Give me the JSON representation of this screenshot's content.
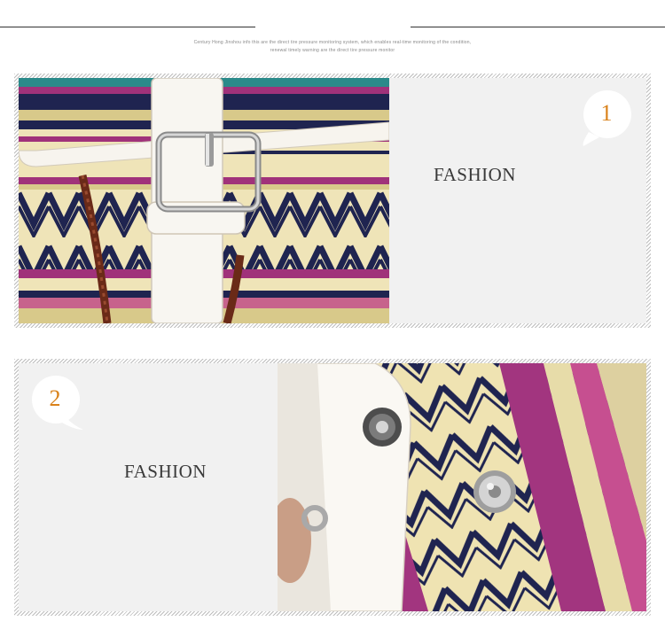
{
  "caption": {
    "line1": "Century Hong Jinshou info this are the direct tire pressure monitoring system, which enables real-time monitoring of the condition,",
    "line2": "renewal timely warning are the direct tire pressure monitor"
  },
  "sections": [
    {
      "number": "1",
      "label": "FASHION",
      "photo_subject": "buckle-strap-detail"
    },
    {
      "number": "2",
      "label": "FASHION",
      "photo_subject": "magnetic-snap-detail"
    }
  ],
  "colors": {
    "accent_number": "#d9821b",
    "label_text": "#3a3a3a",
    "panel_bg": "#f1f1f1",
    "stripe": "#bdbdbd"
  }
}
